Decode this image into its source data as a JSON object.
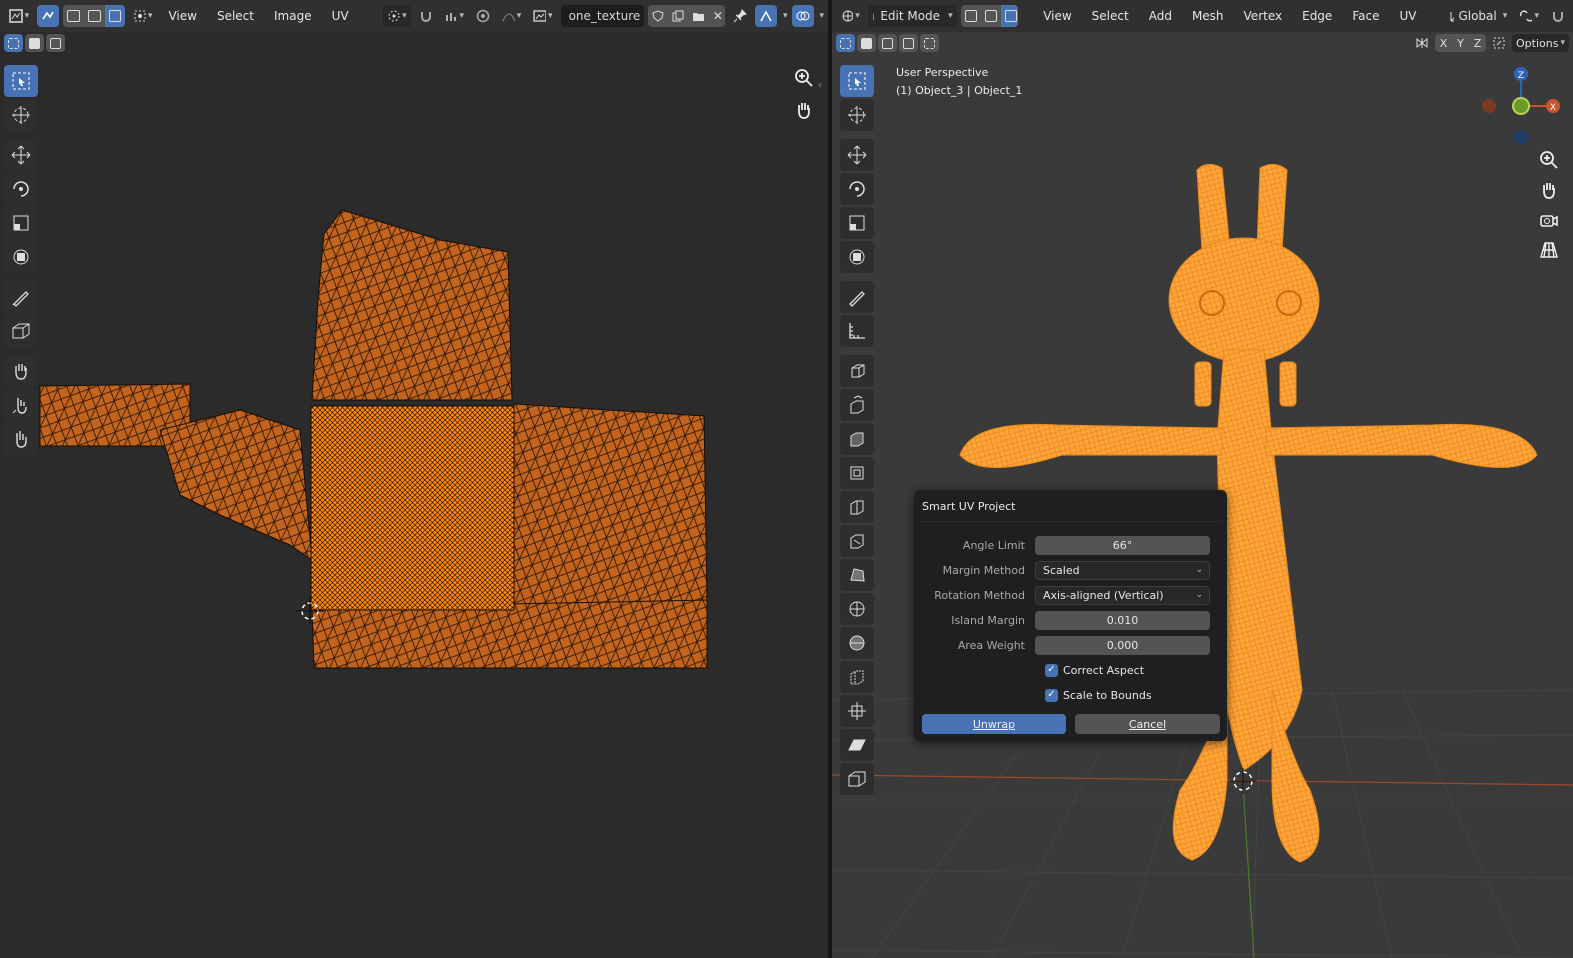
{
  "uv_editor": {
    "header": {
      "menus": [
        "View",
        "Select",
        "Image",
        "UV"
      ],
      "image_name": "one_texture"
    }
  },
  "viewport": {
    "header": {
      "mode": "Edit Mode",
      "menus": [
        "View",
        "Select",
        "Add",
        "Mesh",
        "Vertex",
        "Edge",
        "Face",
        "UV"
      ],
      "orientation": "Global",
      "axes": [
        "X",
        "Y",
        "Z"
      ],
      "options_label": "Options"
    },
    "info": {
      "view_name": "User Perspective",
      "object_line": "(1) Object_3 | Object_1"
    },
    "gizmo": {
      "x": "X",
      "y": "Y",
      "z": "Z"
    }
  },
  "dialog": {
    "title": "Smart UV Project",
    "rows": [
      {
        "label": "Angle Limit",
        "value": "66°"
      },
      {
        "label": "Margin Method",
        "value": "Scaled"
      },
      {
        "label": "Rotation Method",
        "value": "Axis-aligned (Vertical)"
      },
      {
        "label": "Island Margin",
        "value": "0.010"
      },
      {
        "label": "Area Weight",
        "value": "0.000"
      }
    ],
    "checks": [
      {
        "label": "Correct Aspect",
        "checked": true
      },
      {
        "label": "Scale to Bounds",
        "checked": true
      }
    ],
    "unwrap_label": "Unwrap",
    "cancel_label": "Cancel"
  },
  "colors": {
    "accent": "#4772b3",
    "mesh_selected": "#ff9a1f",
    "uv_face": "#c2641e",
    "x_axis": "#c8552f",
    "y_axis": "#6a9a2a",
    "z_axis": "#2e64b8"
  }
}
